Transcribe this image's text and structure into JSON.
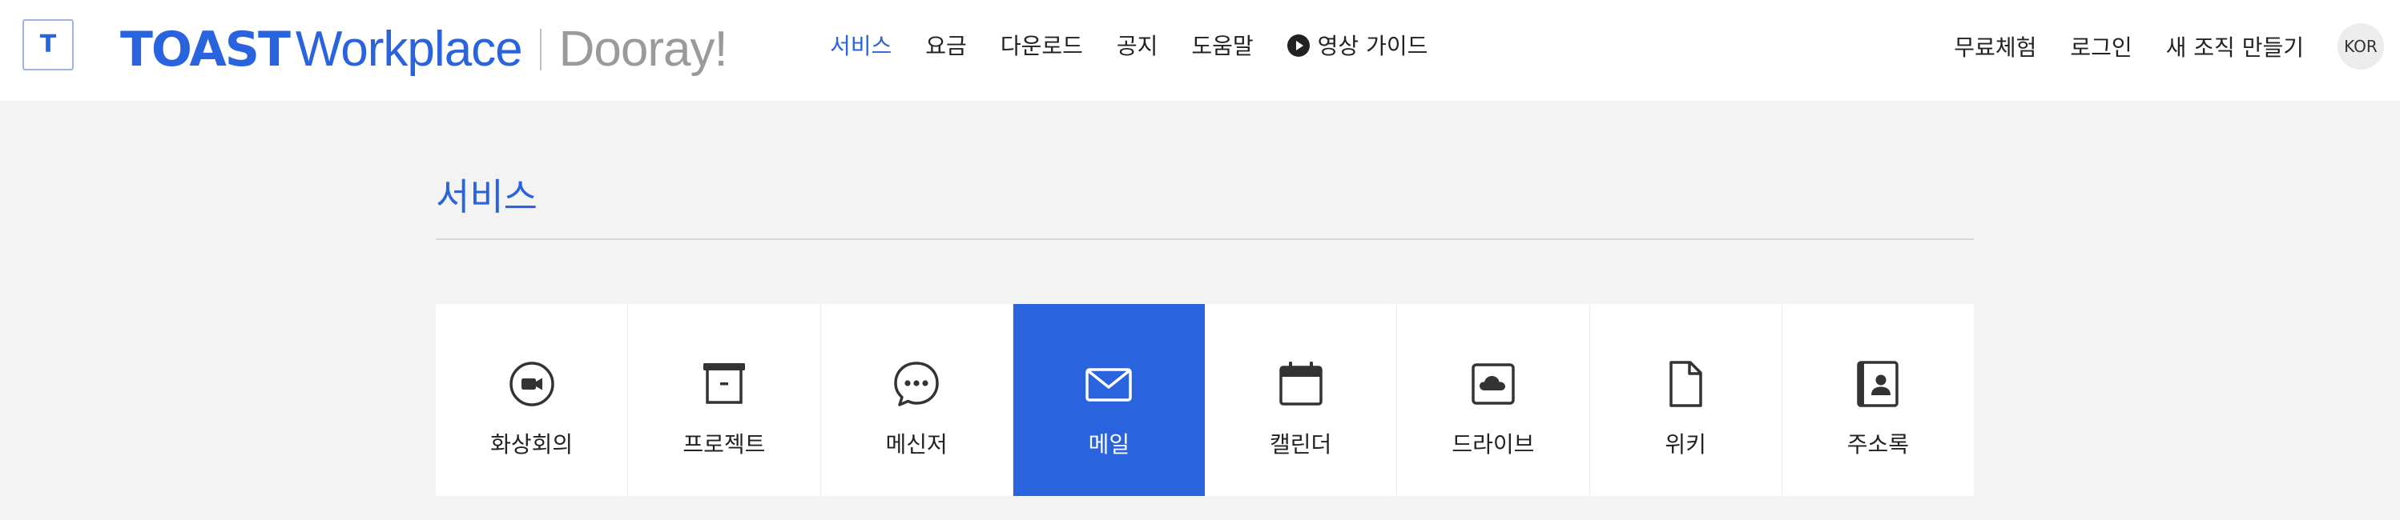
{
  "header": {
    "logo_letter": "T",
    "brand_toast": "TOAST",
    "brand_workplace": "Workplace",
    "brand_dooray": "Dooray!",
    "nav": [
      {
        "label": "서비스",
        "active": true
      },
      {
        "label": "요금"
      },
      {
        "label": "다운로드"
      },
      {
        "label": "공지"
      },
      {
        "label": "도움말"
      },
      {
        "label": "영상 가이드",
        "icon": "play-circle-icon"
      }
    ],
    "right": {
      "trial": "무료체험",
      "login": "로그인",
      "new_org": "새 조직 만들기",
      "lang": "KOR"
    }
  },
  "main": {
    "title": "서비스",
    "services": [
      {
        "label": "화상회의",
        "icon": "video-call-icon"
      },
      {
        "label": "프로젝트",
        "icon": "archive-box-icon"
      },
      {
        "label": "메신저",
        "icon": "chat-bubble-icon"
      },
      {
        "label": "메일",
        "icon": "mail-icon",
        "active": true
      },
      {
        "label": "캘린더",
        "icon": "calendar-icon"
      },
      {
        "label": "드라이브",
        "icon": "cloud-drive-icon"
      },
      {
        "label": "위키",
        "icon": "document-icon"
      },
      {
        "label": "주소록",
        "icon": "address-book-icon"
      }
    ]
  },
  "colors": {
    "accent": "#2a63de",
    "background": "#f3f3f3",
    "header_bg": "#ffffff",
    "muted_brand": "#9a9a9a"
  }
}
